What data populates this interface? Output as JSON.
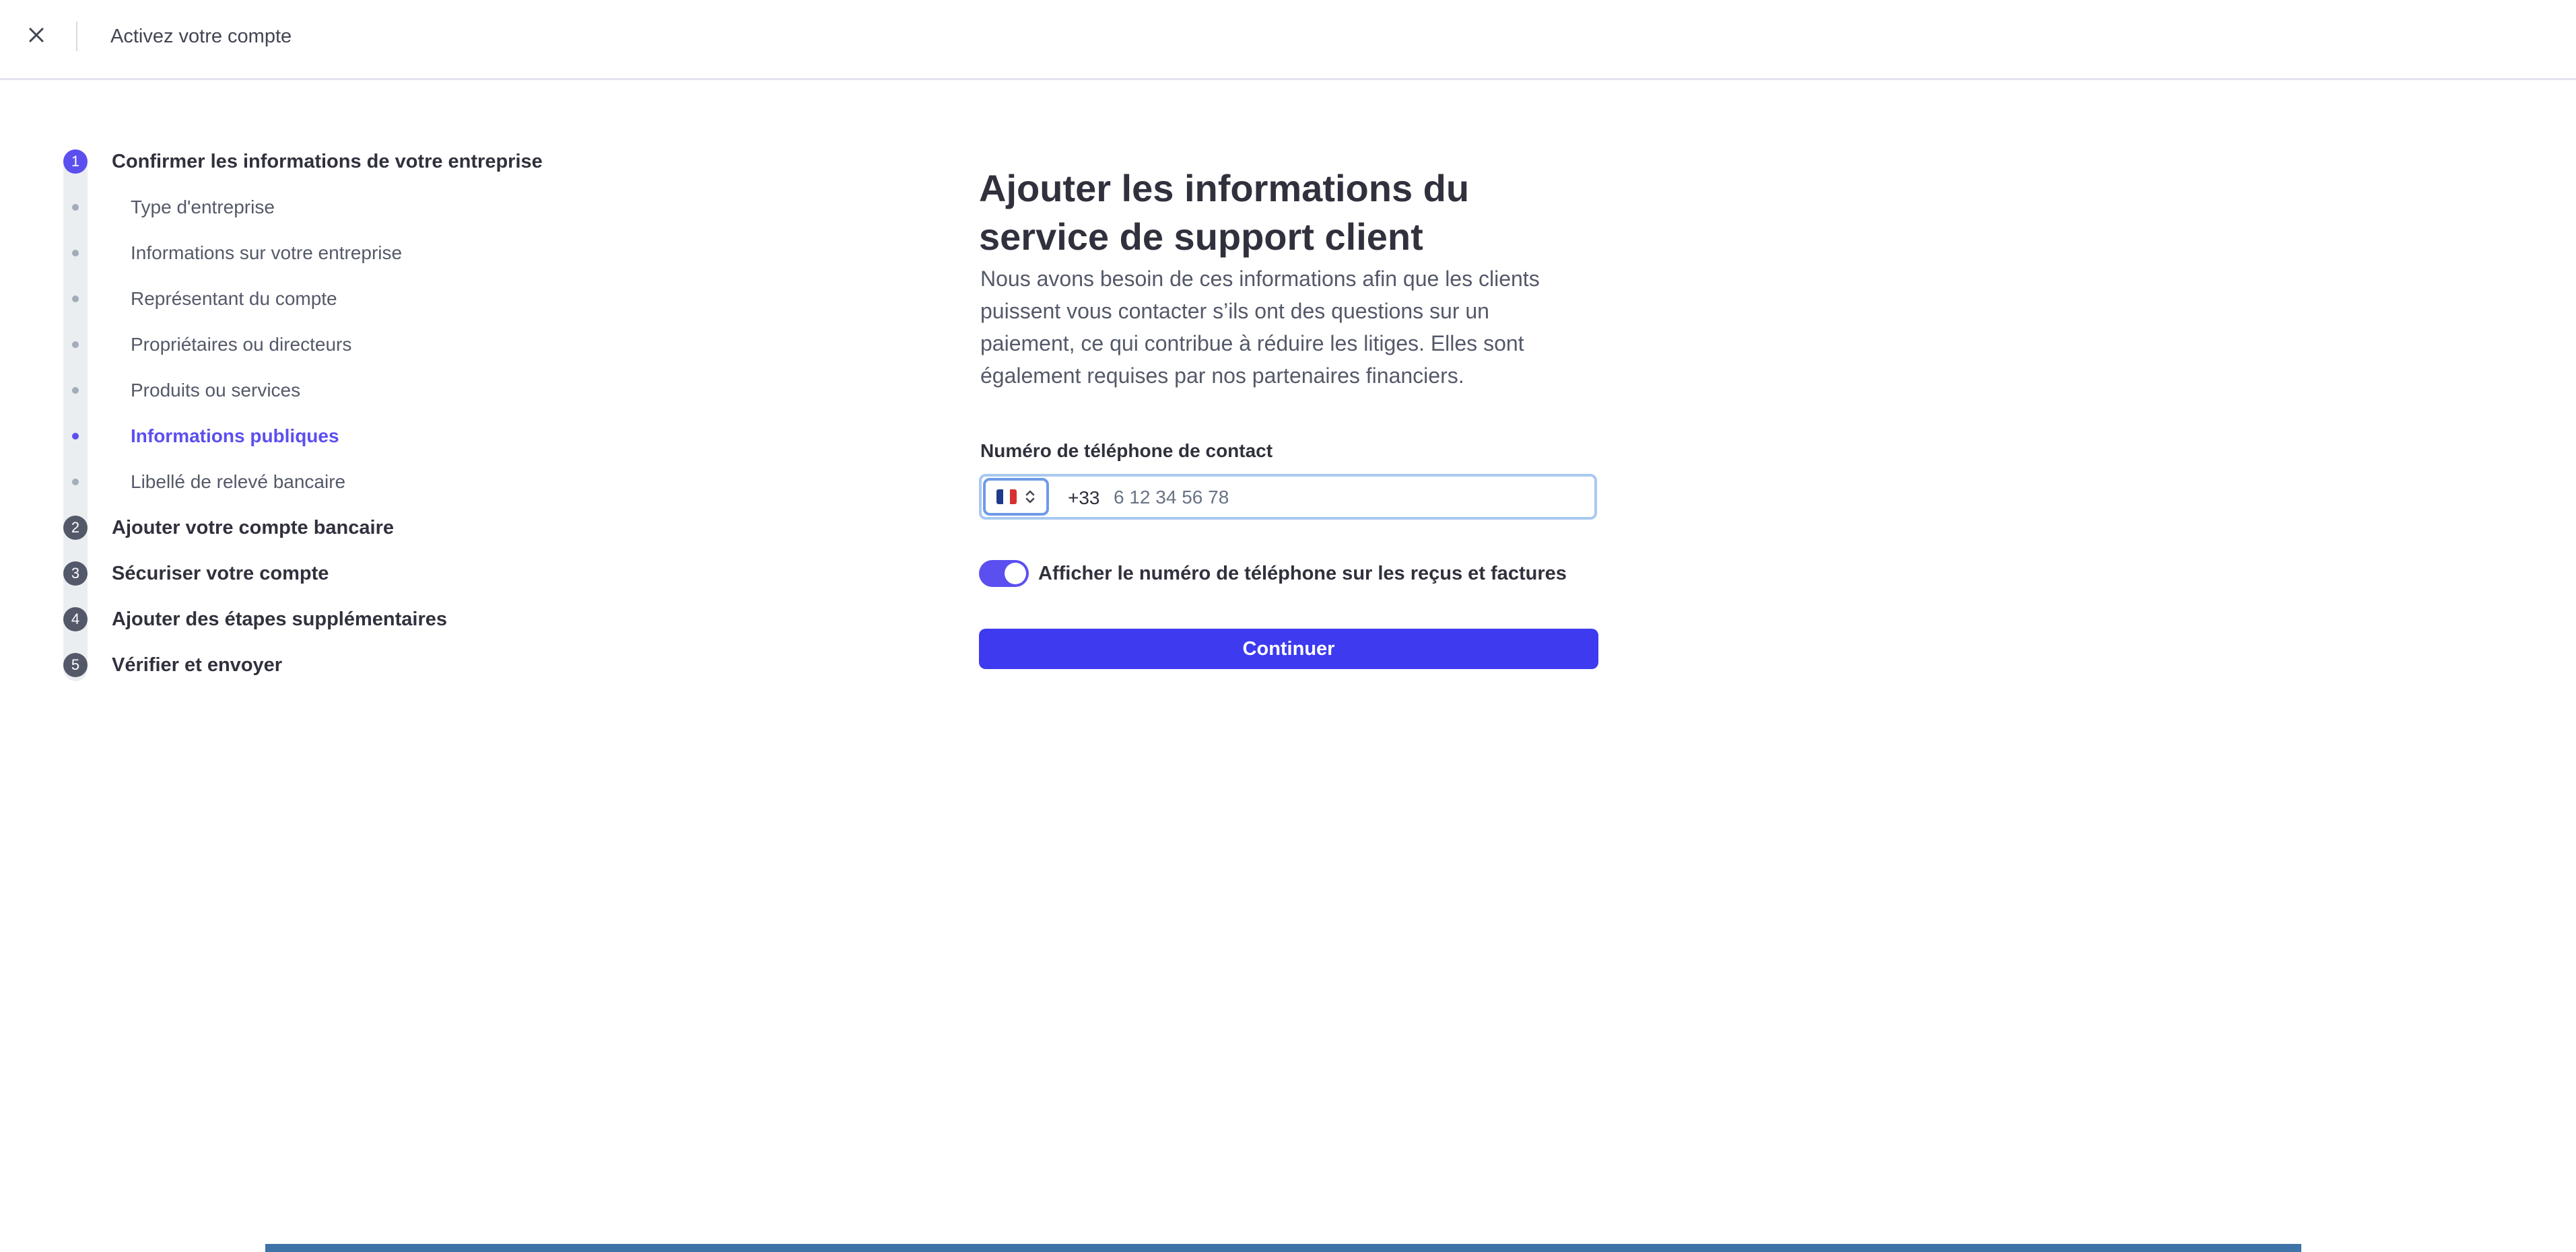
{
  "header": {
    "title": "Activez votre compte"
  },
  "steps": [
    {
      "number": "1",
      "label": "Confirmer les informations de votre entreprise",
      "substeps": [
        {
          "label": "Type d'entreprise"
        },
        {
          "label": "Informations sur votre entreprise"
        },
        {
          "label": "Représentant du compte"
        },
        {
          "label": "Propriétaires ou directeurs"
        },
        {
          "label": "Produits ou services"
        },
        {
          "label": "Informations publiques"
        },
        {
          "label": "Libellé de relevé bancaire"
        }
      ]
    },
    {
      "number": "2",
      "label": "Ajouter votre compte bancaire"
    },
    {
      "number": "3",
      "label": "Sécuriser votre compte"
    },
    {
      "number": "4",
      "label": "Ajouter des étapes supplémentaires"
    },
    {
      "number": "5",
      "label": "Vérifier et envoyer"
    }
  ],
  "form": {
    "title": "Ajouter les informations du service de support client",
    "description": "Nous avons besoin de ces informations afin que les clients puissent vous contacter s’ils ont des questions sur un paiement, ce qui contribue à réduire les litiges. Elles sont également requises par nos partenaires financiers.",
    "phone_label": "Numéro de téléphone de contact",
    "dial_code": "+33",
    "phone_value": "",
    "phone_placeholder": "6 12 34 56 78",
    "country_flag": "flag-france-icon",
    "toggle_on": true,
    "toggle_label": "Afficher le numéro de téléphone sur les reçus et factures",
    "continue_label": "Continuer"
  },
  "colors": {
    "accent": "#5b4ff0",
    "primary_button": "#3d3af0",
    "step_inactive": "#545969",
    "focus_ring": "#a9c9f0"
  }
}
